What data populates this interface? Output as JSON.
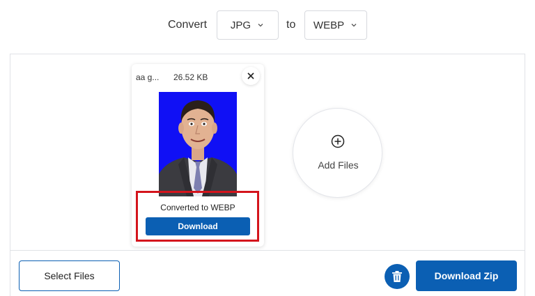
{
  "converter": {
    "convert_label": "Convert",
    "from_format": "JPG",
    "to_label": "to",
    "to_format": "WEBP"
  },
  "file_card": {
    "file_name": "aa g...",
    "file_size": "26.52 KB",
    "status_text": "Converted to WEBP",
    "download_label": "Download"
  },
  "add_files": {
    "label": "Add Files"
  },
  "bottom_bar": {
    "select_files_label": "Select Files",
    "download_zip_label": "Download Zip"
  },
  "icons": {
    "close": "close-icon",
    "chevron": "chevron-down-icon",
    "add": "plus-circle-icon",
    "trash": "trash-icon"
  },
  "colors": {
    "accent": "#0b5fb3",
    "highlight": "#d4141c",
    "thumb_bg": "#1010f5"
  }
}
